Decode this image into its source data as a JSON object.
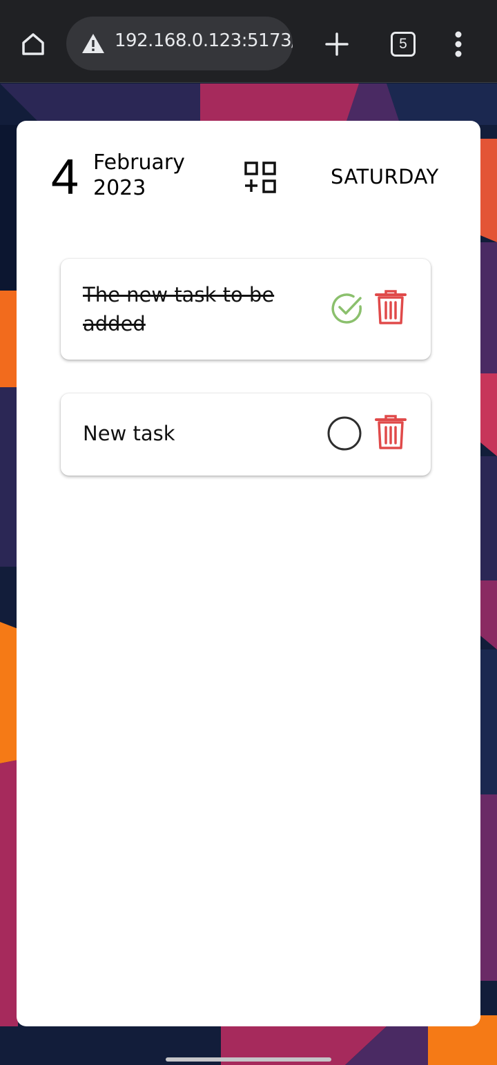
{
  "browser": {
    "url": "192.168.0.123:5173/",
    "tab_count": "5"
  },
  "date": {
    "day": "4",
    "month": "February",
    "year": "2023",
    "weekday": "SATURDAY"
  },
  "tasks": [
    {
      "text": "The new task to be added",
      "completed": true
    },
    {
      "text": "New task",
      "completed": false
    }
  ],
  "colors": {
    "done_check": "#8bc06d",
    "delete": "#e04a4a",
    "pending_circle": "#2e2e2e"
  },
  "icons": [
    "home-icon",
    "warning-icon",
    "plus-icon",
    "tabs-icon",
    "more-vert-icon",
    "add-task-icon",
    "check-circle-icon",
    "empty-circle-icon",
    "trash-icon"
  ]
}
